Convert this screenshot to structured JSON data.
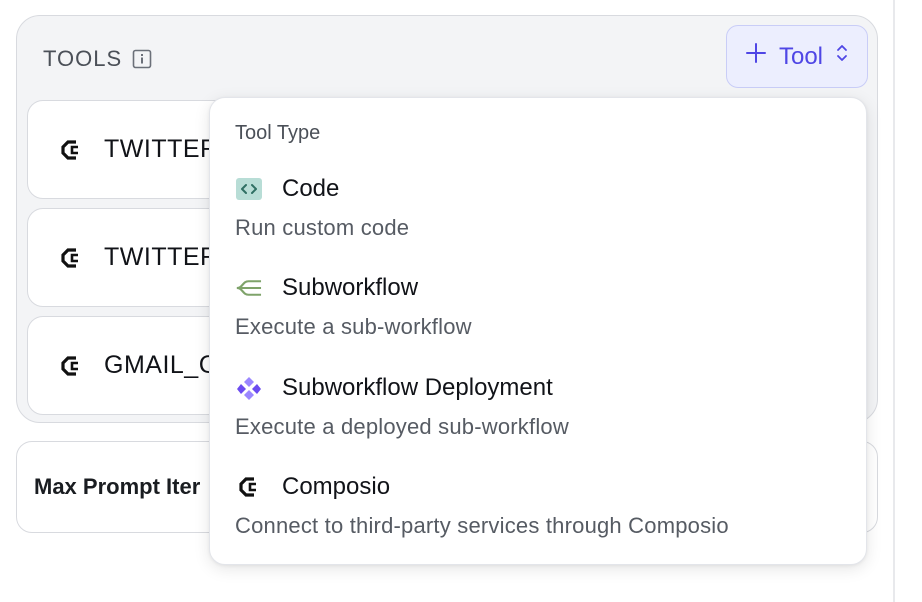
{
  "tools": {
    "title": "TOOLS",
    "add_button_label": "Tool",
    "rows": [
      {
        "label": "TWITTER"
      },
      {
        "label": "TWITTER"
      },
      {
        "label": "GMAIL_C"
      }
    ]
  },
  "max_prompt": {
    "label": "Max Prompt Iter"
  },
  "dropdown": {
    "heading": "Tool Type",
    "items": [
      {
        "title": "Code",
        "description": "Run custom code",
        "icon": "code-icon",
        "color": "#b8ddd6"
      },
      {
        "title": "Subworkflow",
        "description": "Execute a sub-workflow",
        "icon": "subworkflow-icon",
        "color": "#7fa36a"
      },
      {
        "title": "Subworkflow Deployment",
        "description": "Execute a deployed sub-workflow",
        "icon": "subworkflow-deployment-icon",
        "color": "#7c5cff"
      },
      {
        "title": "Composio",
        "description": "Connect to third-party services through Composio",
        "icon": "composio-icon",
        "color": "#111318"
      }
    ]
  },
  "colors": {
    "accent": "#4f46e5",
    "accent_bg": "#eceefe"
  }
}
